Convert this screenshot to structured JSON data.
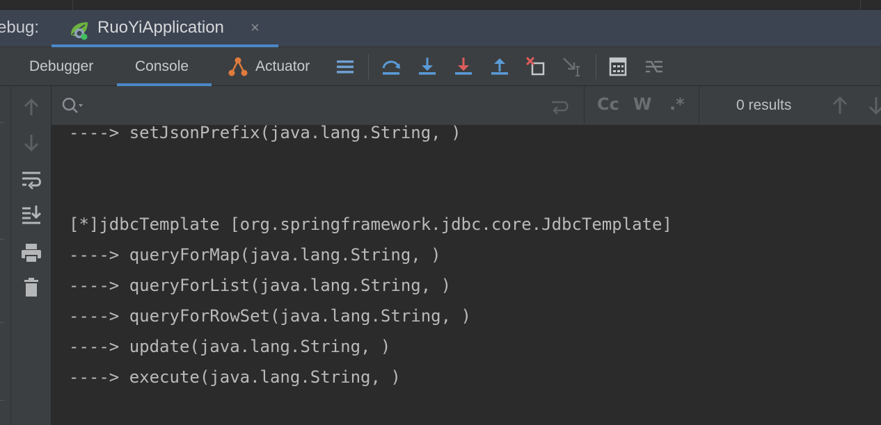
{
  "session": {
    "label": "ebug:",
    "tab_name": "RuoYiApplication",
    "close_glyph": "×"
  },
  "toolbar": {
    "tabs": [
      "Debugger",
      "Console",
      "Actuator"
    ],
    "active_tab": "Console",
    "accent": "#4a88c7"
  },
  "search": {
    "placeholder": "",
    "value": "",
    "options": [
      "Cc",
      "W",
      ".*"
    ],
    "results_text": "0 results"
  },
  "console": {
    "lines": [
      "----> setJsonPrefix(java.lang.String, )",
      "",
      "",
      "[*]jdbcTemplate [org.springframework.jdbc.core.JdbcTemplate]",
      "----> queryForMap(java.lang.String, )",
      "----> queryForList(java.lang.String, )",
      "----> queryForRowSet(java.lang.String, )",
      "----> update(java.lang.String, )",
      "----> execute(java.lang.String, )"
    ]
  },
  "icons": {
    "app": "spring-boot-app-icon",
    "toolbar": [
      "layout-icon",
      "step-over-icon",
      "step-into-icon",
      "force-step-into-icon",
      "step-out-icon",
      "drop-frame-icon",
      "run-to-cursor-icon",
      "evaluate-expression-icon",
      "trace-current-stream-icon"
    ],
    "side": [
      "up-arrow-icon",
      "down-arrow-icon",
      "soft-wrap-icon",
      "scroll-to-end-icon",
      "print-icon",
      "clear-all-icon"
    ]
  }
}
